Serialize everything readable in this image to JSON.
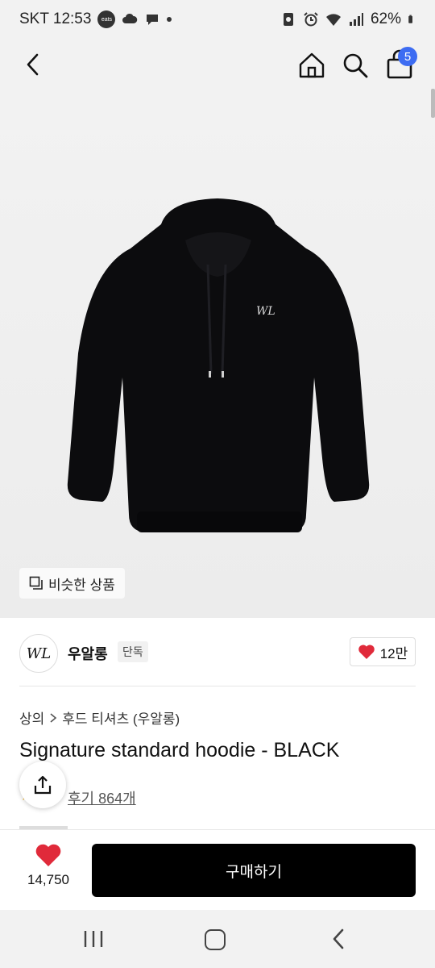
{
  "status_bar": {
    "carrier_time": "SKT 12:53",
    "eats_badge": "eats",
    "battery": "62%",
    "icons": [
      "coupang-eats-icon",
      "cloud-icon",
      "chat-bubble-icon",
      "notification-dot",
      "vpn-key-icon",
      "alarm-icon",
      "wifi-icon",
      "signal-icon",
      "battery-icon"
    ]
  },
  "header": {
    "icons": [
      "back-arrow-icon",
      "home-icon",
      "search-icon",
      "shopping-bag-icon"
    ],
    "cart_count": "5"
  },
  "product_image": {
    "similar_button_label": "비슷한 상품",
    "product_logo": "WL"
  },
  "brand": {
    "logo_text": "WL",
    "name": "우알롱",
    "tag": "단독",
    "likes": "12만"
  },
  "product": {
    "breadcrumb": [
      "상의",
      "후드 티셔츠 (우알롱)"
    ],
    "title": "Signature standard hoodie - BLACK",
    "review_link": "후기 864개"
  },
  "action_bar": {
    "wish_count": "14,750",
    "buy_label": "구매하기"
  },
  "colors": {
    "accent": "#3d6cf2",
    "heart": "#e02a3a",
    "buy_button": "#000000"
  },
  "nav_bar": {
    "icons": [
      "recent-apps-icon",
      "home-nav-icon",
      "back-nav-icon"
    ]
  }
}
